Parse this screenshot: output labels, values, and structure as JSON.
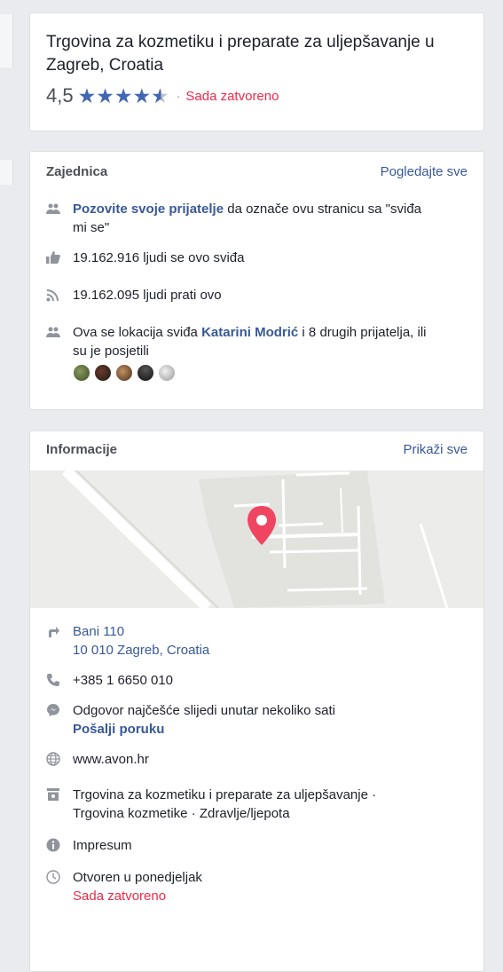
{
  "header": {
    "category": "Trgovina za kozmetiku i preparate za uljepšavanje u Zagreb, Croatia",
    "rating": "4,5",
    "rating_value": 4.5,
    "rating_max": 5,
    "separator": "·",
    "status": "Sada zatvoreno"
  },
  "community": {
    "title": "Zajednica",
    "see_all": "Pogledajte sve",
    "invite_link": "Pozovite svoje prijatelje",
    "invite_rest": " da označe ovu stranicu sa \"sviđa mi se\"",
    "likes": "19.162.916 ljudi se ovo sviđa",
    "follows": "19.162.095 ljudi prati ovo",
    "friends_pre": "Ova se lokacija sviđa ",
    "friends_name": "Katarini Modrić",
    "friends_post": " i 8 drugih prijatelja, ili su je posjetili"
  },
  "info": {
    "title": "Informacije",
    "see_all": "Prikaži sve",
    "address_line1": "Bani 110",
    "address_line2": "10 010 Zagreb, Croatia",
    "phone": "+385 1 6650 010",
    "response": "Odgovor najčešće slijedi unutar nekoliko sati",
    "send_message": "Pošalji poruku",
    "website": "www.avon.hr",
    "categories": "Trgovina za kozmetiku i preparate za uljepšavanje · Trgovina kozmetike · Zdravlje/ljepota",
    "impressum": "Impresum",
    "hours": "Otvoren u ponedjeljak",
    "hours_status": "Sada zatvoreno"
  },
  "colors": {
    "link": "#385898",
    "star": "#4267b2",
    "closed": "#f02849",
    "pin": "#ef4561"
  }
}
